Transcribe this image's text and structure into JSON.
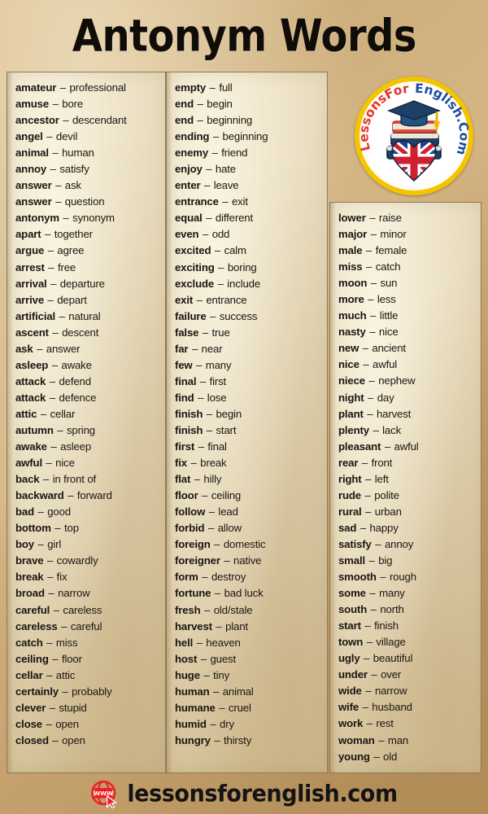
{
  "page": {
    "title": "Antonym Words",
    "background_color": "#cdae7c",
    "panel_color": "#e7dabb",
    "border_color": "#8e7a55"
  },
  "logo": {
    "name": "lessonsforenglish-logo",
    "text_part_1": "LessonsFor",
    "text_part_2": "English.Com",
    "color_part_1": "#e8342a",
    "color_part_2": "#1c4ea3",
    "ring_color": "#f5c400"
  },
  "footer": {
    "site": "lessonsforenglish.com",
    "globe_label": "WWW",
    "globe_color": "#ee1c25"
  },
  "columns": [
    {
      "id": "column-1",
      "entries": [
        {
          "term": "amateur",
          "dash": "–",
          "antonym": "professional"
        },
        {
          "term": "amuse",
          "dash": "–",
          "antonym": "bore"
        },
        {
          "term": "ancestor",
          "dash": "–",
          "antonym": "descendant"
        },
        {
          "term": "angel",
          "dash": "–",
          "antonym": "devil"
        },
        {
          "term": "animal",
          "dash": "–",
          "antonym": "human"
        },
        {
          "term": "annoy",
          "dash": "–",
          "antonym": "satisfy"
        },
        {
          "term": "answer",
          "dash": "–",
          "antonym": "ask"
        },
        {
          "term": "answer",
          "dash": "–",
          "antonym": "question"
        },
        {
          "term": "antonym",
          "dash": "–",
          "antonym": "synonym"
        },
        {
          "term": "apart",
          "dash": "–",
          "antonym": "together"
        },
        {
          "term": "argue",
          "dash": "–",
          "antonym": "agree"
        },
        {
          "term": "arrest",
          "dash": "–",
          "antonym": "free"
        },
        {
          "term": "arrival",
          "dash": "–",
          "antonym": "departure"
        },
        {
          "term": "arrive",
          "dash": "–",
          "antonym": "depart"
        },
        {
          "term": "artificial",
          "dash": "–",
          "antonym": "natural"
        },
        {
          "term": "ascent",
          "dash": "–",
          "antonym": "descent"
        },
        {
          "term": "ask",
          "dash": "–",
          "antonym": "answer"
        },
        {
          "term": "asleep",
          "dash": "–",
          "antonym": "awake"
        },
        {
          "term": "attack",
          "dash": "–",
          "antonym": "defend"
        },
        {
          "term": "attack",
          "dash": "–",
          "antonym": "defence"
        },
        {
          "term": "attic",
          "dash": "–",
          "antonym": "cellar"
        },
        {
          "term": "autumn",
          "dash": "–",
          "antonym": "spring"
        },
        {
          "term": "awake",
          "dash": "–",
          "antonym": "asleep"
        },
        {
          "term": "awful",
          "dash": "–",
          "antonym": "nice"
        },
        {
          "term": "back",
          "dash": "–",
          "antonym": "in front of"
        },
        {
          "term": "backward",
          "dash": "–",
          "antonym": "forward"
        },
        {
          "term": "bad",
          "dash": "–",
          "antonym": "good"
        },
        {
          "term": "bottom",
          "dash": "–",
          "antonym": "top"
        },
        {
          "term": "boy",
          "dash": "–",
          "antonym": "girl"
        },
        {
          "term": "brave",
          "dash": "–",
          "antonym": "cowardly"
        },
        {
          "term": "break",
          "dash": "–",
          "antonym": "fix"
        },
        {
          "term": "broad",
          "dash": "–",
          "antonym": "narrow"
        },
        {
          "term": "careful",
          "dash": "–",
          "antonym": "careless"
        },
        {
          "term": "careless",
          "dash": "–",
          "antonym": "careful"
        },
        {
          "term": "catch",
          "dash": "–",
          "antonym": "miss"
        },
        {
          "term": "ceiling",
          "dash": "–",
          "antonym": "floor"
        },
        {
          "term": "cellar",
          "dash": "–",
          "antonym": "attic"
        },
        {
          "term": "certainly",
          "dash": "–",
          "antonym": "probably"
        },
        {
          "term": "clever",
          "dash": "–",
          "antonym": "stupid"
        },
        {
          "term": "close",
          "dash": "–",
          "antonym": "open"
        },
        {
          "term": "closed",
          "dash": "–",
          "antonym": "open"
        }
      ]
    },
    {
      "id": "column-2",
      "entries": [
        {
          "term": "empty",
          "dash": "–",
          "antonym": "full"
        },
        {
          "term": "end",
          "dash": "–",
          "antonym": "begin"
        },
        {
          "term": "end",
          "dash": "–",
          "antonym": "beginning"
        },
        {
          "term": "ending",
          "dash": "–",
          "antonym": "beginning"
        },
        {
          "term": "enemy",
          "dash": "–",
          "antonym": "friend"
        },
        {
          "term": "enjoy",
          "dash": "–",
          "antonym": "hate"
        },
        {
          "term": "enter",
          "dash": "–",
          "antonym": "leave"
        },
        {
          "term": "entrance",
          "dash": "–",
          "antonym": "exit"
        },
        {
          "term": "equal",
          "dash": "–",
          "antonym": "different"
        },
        {
          "term": "even",
          "dash": "–",
          "antonym": "odd"
        },
        {
          "term": "excited",
          "dash": "–",
          "antonym": "calm"
        },
        {
          "term": "exciting",
          "dash": "–",
          "antonym": "boring"
        },
        {
          "term": "exclude",
          "dash": "–",
          "antonym": "include"
        },
        {
          "term": "exit",
          "dash": "–",
          "antonym": "entrance"
        },
        {
          "term": "failure",
          "dash": "–",
          "antonym": "success"
        },
        {
          "term": "false",
          "dash": "–",
          "antonym": "true"
        },
        {
          "term": "far",
          "dash": "–",
          "antonym": "near"
        },
        {
          "term": "few",
          "dash": "–",
          "antonym": "many"
        },
        {
          "term": "final",
          "dash": "–",
          "antonym": "first"
        },
        {
          "term": "find",
          "dash": "–",
          "antonym": "lose"
        },
        {
          "term": "finish",
          "dash": "–",
          "antonym": "begin"
        },
        {
          "term": "finish",
          "dash": "–",
          "antonym": "start"
        },
        {
          "term": "first",
          "dash": "–",
          "antonym": "final"
        },
        {
          "term": "fix",
          "dash": "–",
          "antonym": "break"
        },
        {
          "term": "flat",
          "dash": "–",
          "antonym": "hilly"
        },
        {
          "term": "floor",
          "dash": "–",
          "antonym": "ceiling"
        },
        {
          "term": "follow",
          "dash": "–",
          "antonym": "lead"
        },
        {
          "term": "forbid",
          "dash": "–",
          "antonym": "allow"
        },
        {
          "term": "foreign",
          "dash": "–",
          "antonym": "domestic"
        },
        {
          "term": "foreigner",
          "dash": "–",
          "antonym": "native"
        },
        {
          "term": "form",
          "dash": "–",
          "antonym": "destroy"
        },
        {
          "term": "fortune",
          "dash": "–",
          "antonym": "bad luck"
        },
        {
          "term": "fresh",
          "dash": "–",
          "antonym": "old/stale"
        },
        {
          "term": "harvest",
          "dash": "–",
          "antonym": "plant"
        },
        {
          "term": "hell",
          "dash": "–",
          "antonym": "heaven"
        },
        {
          "term": "host",
          "dash": "–",
          "antonym": "guest"
        },
        {
          "term": "huge",
          "dash": "–",
          "antonym": "tiny"
        },
        {
          "term": "human",
          "dash": "–",
          "antonym": "animal"
        },
        {
          "term": "humane",
          "dash": "–",
          "antonym": "cruel"
        },
        {
          "term": "humid",
          "dash": "–",
          "antonym": "dry"
        },
        {
          "term": "hungry",
          "dash": "–",
          "antonym": "thirsty"
        }
      ]
    },
    {
      "id": "column-3",
      "entries": [
        {
          "term": "lower",
          "dash": "–",
          "antonym": "raise"
        },
        {
          "term": "major",
          "dash": "–",
          "antonym": "minor"
        },
        {
          "term": "male",
          "dash": "–",
          "antonym": "female"
        },
        {
          "term": "miss",
          "dash": "–",
          "antonym": "catch"
        },
        {
          "term": "moon",
          "dash": "–",
          "antonym": "sun"
        },
        {
          "term": "more",
          "dash": "–",
          "antonym": "less"
        },
        {
          "term": "much",
          "dash": "–",
          "antonym": "little"
        },
        {
          "term": "nasty",
          "dash": "–",
          "antonym": "nice"
        },
        {
          "term": "new",
          "dash": "–",
          "antonym": "ancient"
        },
        {
          "term": "nice",
          "dash": "–",
          "antonym": "awful"
        },
        {
          "term": "niece",
          "dash": "–",
          "antonym": "nephew"
        },
        {
          "term": "night",
          "dash": "–",
          "antonym": "day"
        },
        {
          "term": "plant",
          "dash": "–",
          "antonym": "harvest"
        },
        {
          "term": "plenty",
          "dash": "–",
          "antonym": "lack"
        },
        {
          "term": "pleasant",
          "dash": "–",
          "antonym": "awful"
        },
        {
          "term": "rear",
          "dash": "–",
          "antonym": "front"
        },
        {
          "term": "right",
          "dash": "–",
          "antonym": "left"
        },
        {
          "term": "rude",
          "dash": "–",
          "antonym": "polite"
        },
        {
          "term": "rural",
          "dash": "–",
          "antonym": "urban"
        },
        {
          "term": "sad",
          "dash": "–",
          "antonym": "happy"
        },
        {
          "term": "satisfy",
          "dash": "–",
          "antonym": "annoy"
        },
        {
          "term": "small",
          "dash": "–",
          "antonym": "big"
        },
        {
          "term": "smooth",
          "dash": "–",
          "antonym": "rough"
        },
        {
          "term": "some",
          "dash": "–",
          "antonym": "many"
        },
        {
          "term": "south",
          "dash": "–",
          "antonym": "north"
        },
        {
          "term": "start",
          "dash": "–",
          "antonym": "finish"
        },
        {
          "term": "town",
          "dash": "–",
          "antonym": "village"
        },
        {
          "term": "ugly",
          "dash": "–",
          "antonym": "beautiful"
        },
        {
          "term": "under",
          "dash": "–",
          "antonym": "over"
        },
        {
          "term": "wide",
          "dash": "–",
          "antonym": "narrow"
        },
        {
          "term": "wife",
          "dash": "–",
          "antonym": "husband"
        },
        {
          "term": "work",
          "dash": "–",
          "antonym": "rest"
        },
        {
          "term": "woman",
          "dash": "–",
          "antonym": "man"
        },
        {
          "term": "young",
          "dash": "–",
          "antonym": "old"
        }
      ]
    }
  ]
}
